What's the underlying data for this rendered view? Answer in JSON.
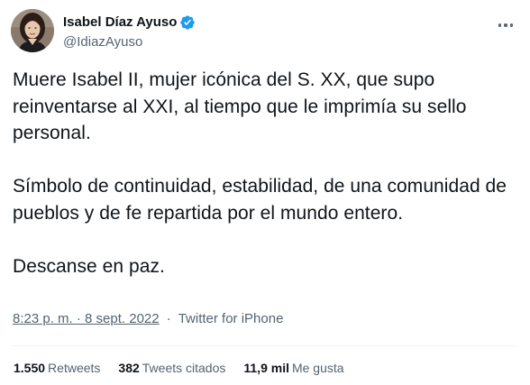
{
  "author": {
    "name": "Isabel Díaz Ayuso",
    "handle": "@IdiazAyuso",
    "verified_color": "#1d9bf0"
  },
  "tweet": {
    "paragraphs": [
      "Muere Isabel II, mujer icónica del S. XX, que supo reinventarse al XXI, al tiempo que le imprimía su sello personal.",
      "Símbolo de continuidad, estabilidad, de una comunidad de pueblos y de fe repartida por el mundo entero.",
      "Descanse en paz."
    ]
  },
  "meta": {
    "timestamp": "8:23 p. m. · 8 sept. 2022",
    "separator": "·",
    "source": "Twitter for iPhone"
  },
  "stats": {
    "retweets": {
      "count": "1.550",
      "label": "Retweets"
    },
    "quotes": {
      "count": "382",
      "label": "Tweets citados"
    },
    "likes": {
      "count": "11,9 mil",
      "label": "Me gusta"
    }
  },
  "icons": {
    "verified": "verified-badge-icon",
    "more": "more-options-icon"
  }
}
